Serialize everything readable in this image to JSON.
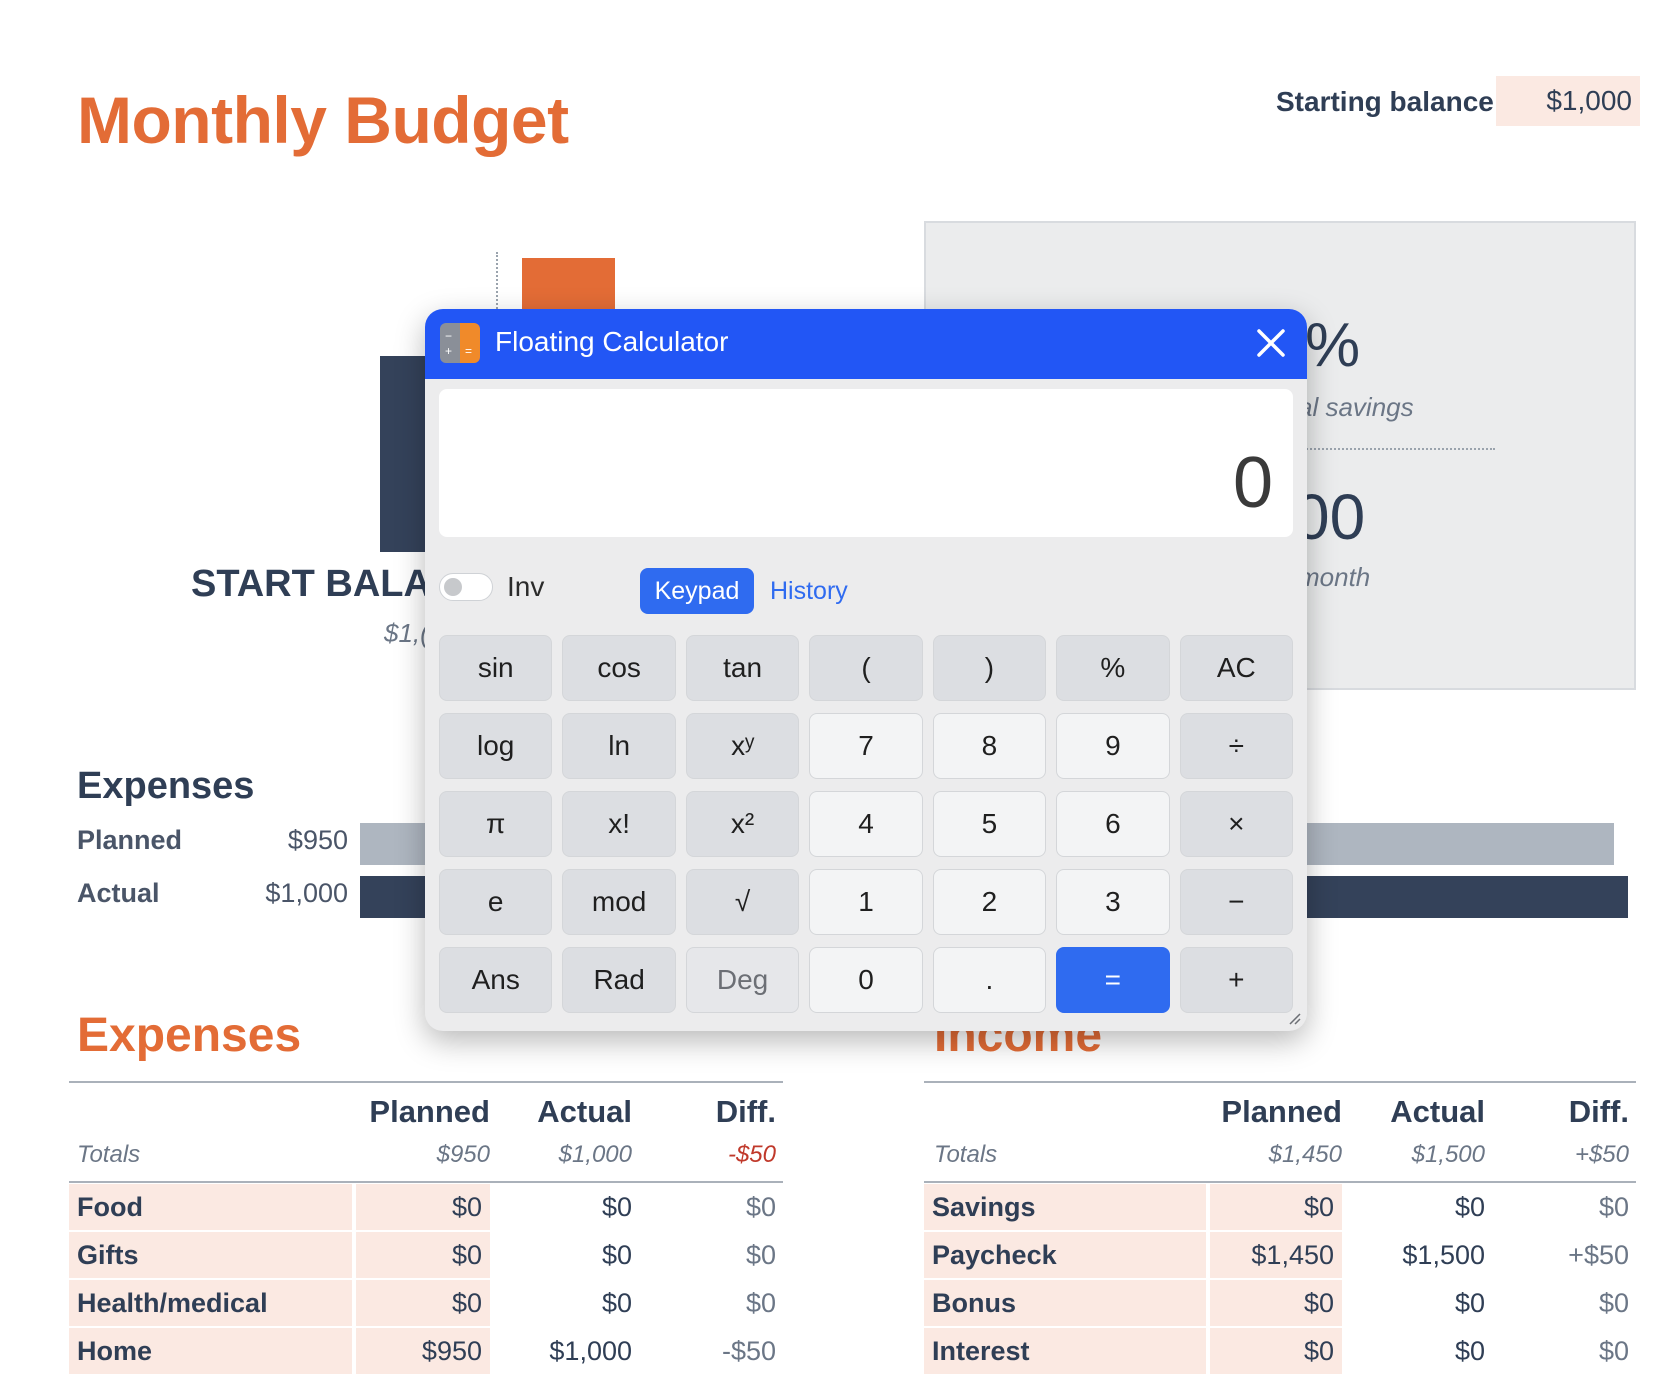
{
  "sheet": {
    "title": "Monthly Budget",
    "starting_balance_label": "Starting balance:",
    "starting_balance_value": "$1,000",
    "start_balance_label": "START BALAN",
    "start_balance_value": "$1,(",
    "summary": {
      "pct_fragment": "%",
      "savings_fragment": "al savings",
      "value_fragment": "00",
      "month_fragment": "month"
    },
    "expenses_chart": {
      "heading": "Expenses",
      "planned_label": "Planned",
      "planned_value": "$950",
      "actual_label": "Actual",
      "actual_value": "$1,000"
    },
    "expenses_table": {
      "title": "Expenses",
      "headers": [
        "Planned",
        "Actual",
        "Diff."
      ],
      "totals": {
        "label": "Totals",
        "planned": "$950",
        "actual": "$1,000",
        "diff": "-$50"
      },
      "rows": [
        {
          "name": "Food",
          "planned": "$0",
          "actual": "$0",
          "diff": "$0"
        },
        {
          "name": "Gifts",
          "planned": "$0",
          "actual": "$0",
          "diff": "$0"
        },
        {
          "name": "Health/medical",
          "planned": "$0",
          "actual": "$0",
          "diff": "$0"
        },
        {
          "name": "Home",
          "planned": "$950",
          "actual": "$1,000",
          "diff": "-$50"
        }
      ]
    },
    "income_table": {
      "title": "Income",
      "headers": [
        "Planned",
        "Actual",
        "Diff."
      ],
      "totals": {
        "label": "Totals",
        "planned": "$1,450",
        "actual": "$1,500",
        "diff": "+$50"
      },
      "rows": [
        {
          "name": "Savings",
          "planned": "$0",
          "actual": "$0",
          "diff": "$0"
        },
        {
          "name": "Paycheck",
          "planned": "$1,450",
          "actual": "$1,500",
          "diff": "+$50"
        },
        {
          "name": "Bonus",
          "planned": "$0",
          "actual": "$0",
          "diff": "$0"
        },
        {
          "name": "Interest",
          "planned": "$0",
          "actual": "$0",
          "diff": "$0"
        }
      ]
    }
  },
  "calculator": {
    "title": "Floating Calculator",
    "display": "0",
    "inv_label": "Inv",
    "tabs": {
      "keypad": "Keypad",
      "history": "History"
    },
    "keys": [
      [
        "sin",
        "cos",
        "tan",
        "(",
        ")",
        "%",
        "AC"
      ],
      [
        "log",
        "ln",
        "xʸ",
        "7",
        "8",
        "9",
        "÷"
      ],
      [
        "π",
        "x!",
        "x²",
        "4",
        "5",
        "6",
        "×"
      ],
      [
        "e",
        "mod",
        "√",
        "1",
        "2",
        "3",
        "−"
      ],
      [
        "Ans",
        "Rad",
        "Deg",
        "0",
        ".",
        "=",
        "+"
      ]
    ]
  },
  "colors": {
    "accent_orange": "#e36c36",
    "navy": "#34425a",
    "calc_blue": "#2256f5",
    "highlight_row": "#fbe9e2"
  }
}
